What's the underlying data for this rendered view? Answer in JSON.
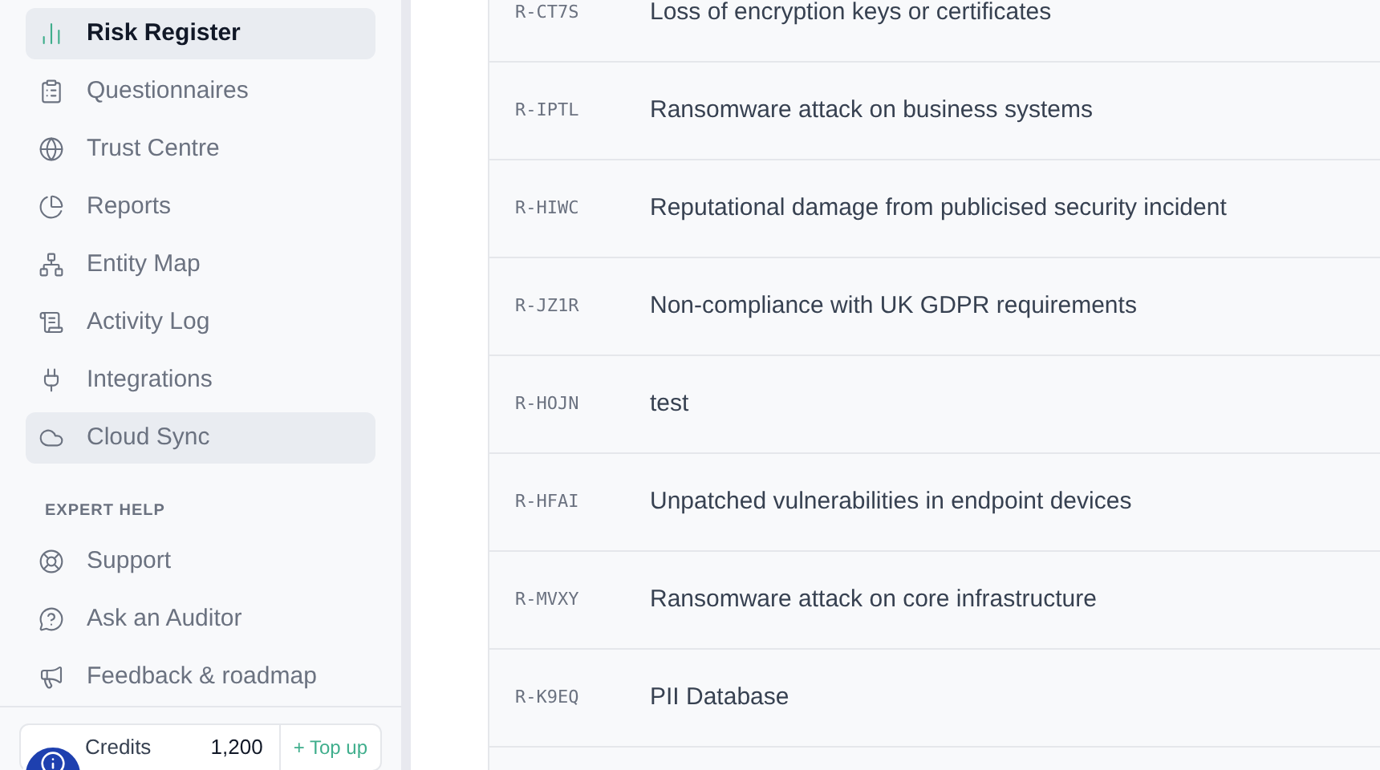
{
  "sidebar": {
    "items": [
      {
        "label": "Risk Register",
        "selected": true,
        "highlighted": true
      },
      {
        "label": "Questionnaires",
        "selected": false,
        "highlighted": false
      },
      {
        "label": "Trust Centre",
        "selected": false,
        "highlighted": false
      },
      {
        "label": "Reports",
        "selected": false,
        "highlighted": false
      },
      {
        "label": "Entity Map",
        "selected": false,
        "highlighted": false
      },
      {
        "label": "Activity Log",
        "selected": false,
        "highlighted": false
      },
      {
        "label": "Integrations",
        "selected": false,
        "highlighted": false
      },
      {
        "label": "Cloud Sync",
        "selected": false,
        "highlighted": true
      }
    ],
    "section_heading": "EXPERT HELP",
    "help_items": [
      {
        "label": "Support"
      },
      {
        "label": "Ask an Auditor"
      },
      {
        "label": "Feedback & roadmap"
      }
    ],
    "credits": {
      "label": "Credits",
      "value": "1,200",
      "action": "+ Top up"
    }
  },
  "table": {
    "rows": [
      {
        "id": "R-CT7S",
        "title": "Loss of encryption keys or certificates"
      },
      {
        "id": "R-IPTL",
        "title": "Ransomware attack on business systems"
      },
      {
        "id": "R-HIWC",
        "title": "Reputational damage from publicised security incident"
      },
      {
        "id": "R-JZ1R",
        "title": "Non-compliance with UK GDPR requirements"
      },
      {
        "id": "R-HOJN",
        "title": "test"
      },
      {
        "id": "R-HFAI",
        "title": "Unpatched vulnerabilities in endpoint devices"
      },
      {
        "id": "R-MVXY",
        "title": "Ransomware attack on core infrastructure"
      },
      {
        "id": "R-K9EQ",
        "title": "PII Database"
      }
    ]
  }
}
